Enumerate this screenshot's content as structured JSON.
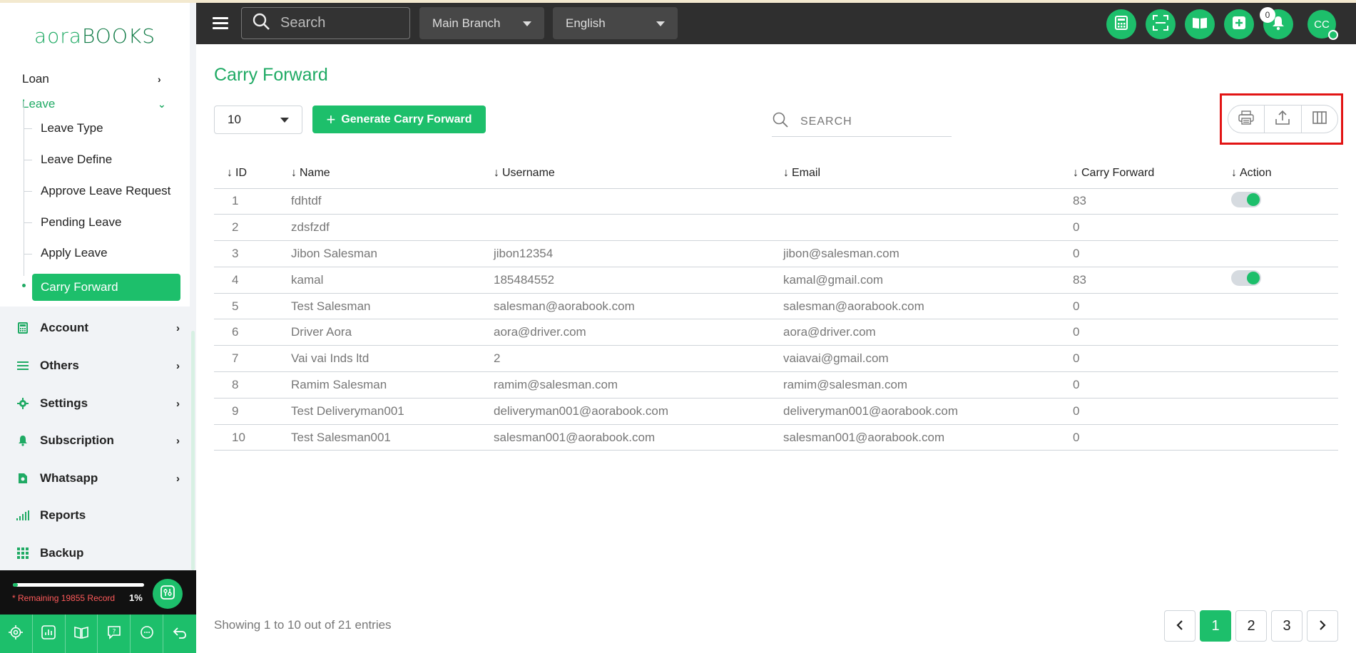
{
  "brand": {
    "part1": "aora",
    "part2": "BOOKS"
  },
  "topbar": {
    "search_placeholder": "Search",
    "branch": "Main Branch",
    "language": "English",
    "notification_count": "0",
    "avatar_initials": "CC"
  },
  "sidebar": {
    "loan": "Loan",
    "leave": "Leave",
    "leave_items": [
      "Leave Type",
      "Leave Define",
      "Approve Leave Request",
      "Pending Leave",
      "Apply Leave",
      "Carry Forward"
    ],
    "menu": [
      "Account",
      "Others",
      "Settings",
      "Subscription",
      "Whatsapp",
      "Reports",
      "Backup"
    ],
    "progress": {
      "text": "* Remaining 19855 Record",
      "percent_label": "1%",
      "percent": 1
    }
  },
  "page": {
    "title": "Carry Forward",
    "per_page": "10",
    "generate_button": "Generate Carry Forward",
    "search_placeholder": "SEARCH"
  },
  "table": {
    "headers": [
      "ID",
      "Name",
      "Username",
      "Email",
      "Carry Forward",
      "Action"
    ],
    "rows": [
      {
        "id": "1",
        "name": "fdhtdf",
        "username": "",
        "email": "",
        "carry": "83",
        "toggle": true
      },
      {
        "id": "2",
        "name": "zdsfzdf",
        "username": "",
        "email": "",
        "carry": "0",
        "toggle": false
      },
      {
        "id": "3",
        "name": "Jibon Salesman",
        "username": "jibon12354",
        "email": "jibon@salesman.com",
        "carry": "0",
        "toggle": false
      },
      {
        "id": "4",
        "name": "kamal",
        "username": "185484552",
        "email": "kamal@gmail.com",
        "carry": "83",
        "toggle": true
      },
      {
        "id": "5",
        "name": "Test Salesman",
        "username": "salesman@aorabook.com",
        "email": "salesman@aorabook.com",
        "carry": "0",
        "toggle": false
      },
      {
        "id": "6",
        "name": "Driver Aora",
        "username": "aora@driver.com",
        "email": "aora@driver.com",
        "carry": "0",
        "toggle": false
      },
      {
        "id": "7",
        "name": "Vai vai Inds ltd",
        "username": "2",
        "email": "vaiavai@gmail.com",
        "carry": "0",
        "toggle": false
      },
      {
        "id": "8",
        "name": "Ramim Salesman",
        "username": "ramim@salesman.com",
        "email": "ramim@salesman.com",
        "carry": "0",
        "toggle": false
      },
      {
        "id": "9",
        "name": "Test Deliveryman001",
        "username": "deliveryman001@aorabook.com",
        "email": "deliveryman001@aorabook.com",
        "carry": "0",
        "toggle": false
      },
      {
        "id": "10",
        "name": "Test Salesman001",
        "username": "salesman001@aorabook.com",
        "email": "salesman001@aorabook.com",
        "carry": "0",
        "toggle": false
      }
    ]
  },
  "footer": {
    "entries": "Showing 1 to 10 out of 21 entries",
    "pages": [
      "1",
      "2",
      "3"
    ]
  }
}
